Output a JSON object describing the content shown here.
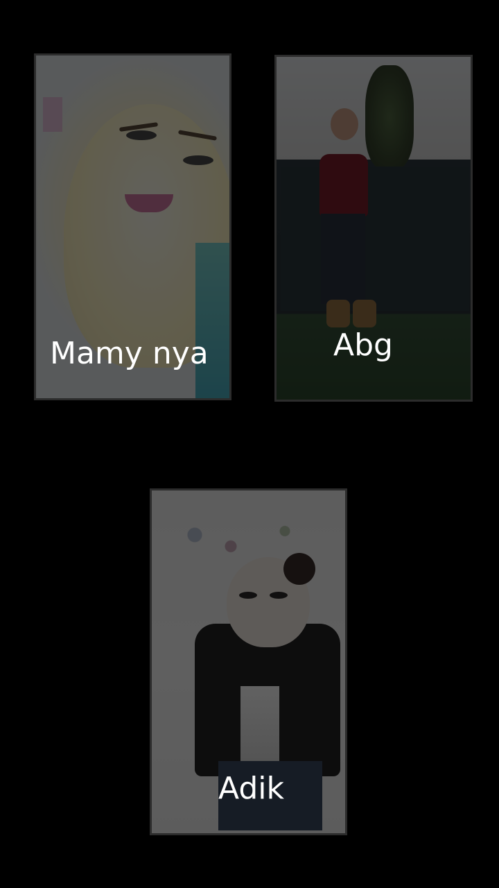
{
  "gallery": {
    "items": [
      {
        "caption": "Mamy nya"
      },
      {
        "caption": "Abg"
      },
      {
        "caption": "Adik"
      }
    ]
  }
}
